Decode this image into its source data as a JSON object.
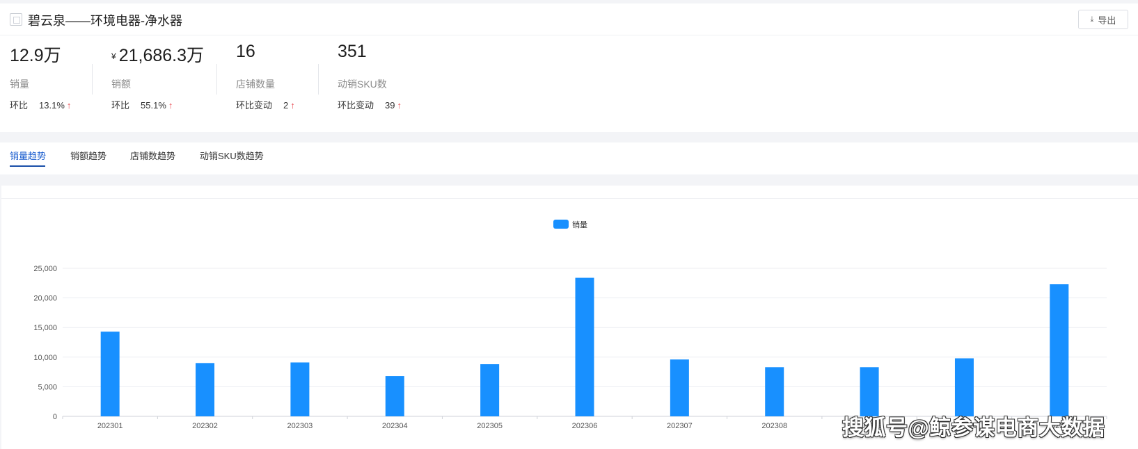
{
  "header": {
    "title": "碧云泉——环境电器-净水器",
    "export_label": "导出"
  },
  "metrics": [
    {
      "value": "12.9万",
      "currency": "",
      "label": "销量",
      "delta_label": "环比",
      "delta_value": "13.1%"
    },
    {
      "value": "21,686.3万",
      "currency": "¥",
      "label": "销额",
      "delta_label": "环比",
      "delta_value": "55.1%"
    },
    {
      "value": "16",
      "currency": "",
      "label": "店铺数量",
      "delta_label": "环比变动",
      "delta_value": "2"
    },
    {
      "value": "351",
      "currency": "",
      "label": "动销SKU数",
      "delta_label": "环比变动",
      "delta_value": "39"
    }
  ],
  "tabs": [
    {
      "label": "销量趋势",
      "active": true
    },
    {
      "label": "销额趋势",
      "active": false
    },
    {
      "label": "店铺数趋势",
      "active": false
    },
    {
      "label": "动销SKU数趋势",
      "active": false
    }
  ],
  "watermark": "搜狐号@鲸参谋电商大数据",
  "colors": {
    "bar": "#1890ff",
    "up_arrow": "#e8484f",
    "active_tab": "#1a5dcf"
  },
  "chart_data": {
    "type": "bar",
    "categories": [
      "202301",
      "202302",
      "202303",
      "202304",
      "202305",
      "202306",
      "202307",
      "202308",
      "202309",
      "202310",
      "202311"
    ],
    "series": [
      {
        "name": "销量",
        "values": [
          14300,
          9000,
          9100,
          6800,
          8800,
          23400,
          9600,
          8300,
          8300,
          9800,
          22300
        ]
      }
    ],
    "y_ticks": [
      "0",
      "5,000",
      "10,000",
      "15,000",
      "20,000",
      "25,000"
    ],
    "ylim": [
      0,
      25000
    ],
    "legend_position": "top-center",
    "grid": true
  }
}
